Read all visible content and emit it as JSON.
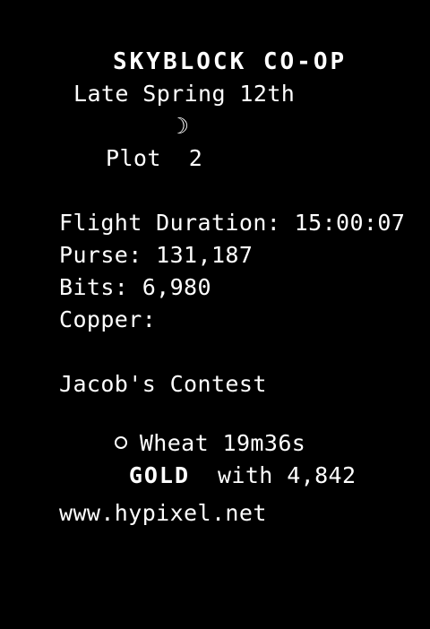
{
  "scoreboard": {
    "title": "SKYBLOCK CO-OP",
    "date": "Late Spring 12th",
    "time_icon": "☽",
    "location": "Plot  2",
    "flight_duration": "Flight Duration: 15:00:07",
    "purse": "Purse: 131,187",
    "bits": "Bits: 6,980",
    "copper": "Copper:",
    "contest_title": "Jacob's Contest",
    "contest_crop": "Wheat 19m36s",
    "contest_rank": "GOLD",
    "contest_score": "with 4,842",
    "server": "www.hypixel.net"
  },
  "colors": {
    "background": "#000000",
    "text": "#ffffff"
  }
}
